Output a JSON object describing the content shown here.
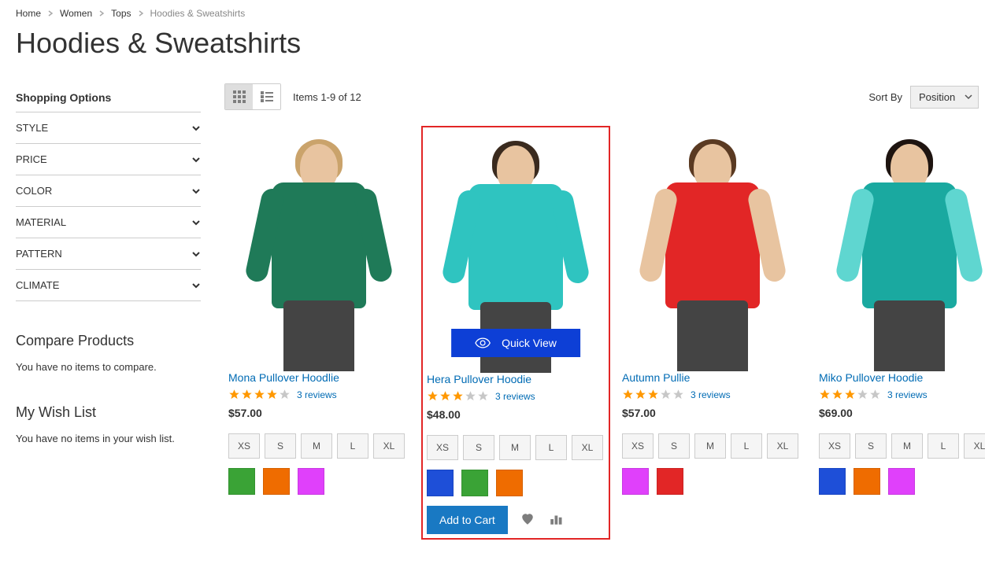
{
  "breadcrumbs": [
    {
      "label": "Home",
      "link": true
    },
    {
      "label": "Women",
      "link": true
    },
    {
      "label": "Tops",
      "link": true
    },
    {
      "label": "Hoodies & Sweatshirts",
      "link": false
    }
  ],
  "page_title": "Hoodies & Sweatshirts",
  "sidebar": {
    "shopping_options_title": "Shopping Options",
    "filters": [
      "STYLE",
      "PRICE",
      "COLOR",
      "MATERIAL",
      "PATTERN",
      "CLIMATE"
    ],
    "compare": {
      "title": "Compare Products",
      "empty": "You have no items to compare."
    },
    "wishlist": {
      "title": "My Wish List",
      "empty": "You have no items in your wish list."
    }
  },
  "toolbar": {
    "count": "Items 1-9 of 12",
    "sort_label": "Sort By",
    "sort_value": "Position"
  },
  "quick_view_label": "Quick View",
  "add_to_cart_label": "Add to Cart",
  "size_options": [
    "XS",
    "S",
    "M",
    "L",
    "XL"
  ],
  "products": [
    {
      "name": "Mona Pullover Hoodlie",
      "price": "$57.00",
      "rating": 4,
      "reviews": "3 reviews",
      "colors": [
        "#3aa336",
        "#ef6c00",
        "#e040fb"
      ],
      "shirt": "#1f7a58",
      "hair": "#caa36b",
      "arms_same": true,
      "highlight": false
    },
    {
      "name": "Hera Pullover Hoodie",
      "price": "$48.00",
      "rating": 3,
      "reviews": "3 reviews",
      "colors": [
        "#1e4fd8",
        "#3aa336",
        "#ef6c00"
      ],
      "shirt": "#2fc4c0",
      "hair": "#3a2a1e",
      "arms_same": true,
      "highlight": true
    },
    {
      "name": "Autumn Pullie",
      "price": "$57.00",
      "rating": 3,
      "reviews": "3 reviews",
      "colors": [
        "#e040fb",
        "#e22626"
      ],
      "shirt": "#e22626",
      "hair": "#5a3a22",
      "arms_same": false,
      "arm_color": "#e8c4a0",
      "highlight": false
    },
    {
      "name": "Miko Pullover Hoodie",
      "price": "$69.00",
      "rating": 3,
      "reviews": "3 reviews",
      "colors": [
        "#1e4fd8",
        "#ef6c00",
        "#e040fb"
      ],
      "shirt": "#1aa9a0",
      "hair": "#1e1410",
      "arms_same": true,
      "arm_color": "#5fd6d0",
      "highlight": false
    }
  ]
}
